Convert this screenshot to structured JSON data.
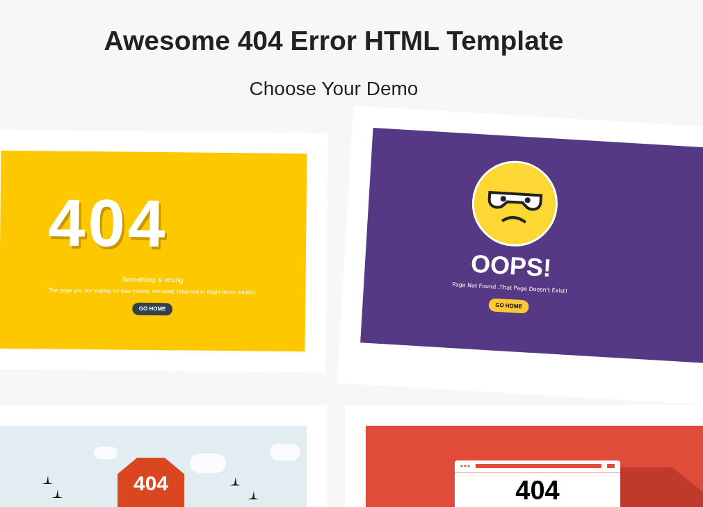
{
  "header": {
    "title": "Awesome 404 Error HTML Template",
    "subtitle": "Choose Your Demo"
  },
  "demos": [
    {
      "kind": "yellow",
      "heading": "404",
      "message": "Something is wrong",
      "detail": "The page you are looking for was moved, removed, renamed or might never existed.",
      "button": "GO HOME"
    },
    {
      "kind": "purple",
      "heading": "OOPS!",
      "message": "Page Not Found .That Page Doesn't Exist!",
      "button": "GO HOME"
    },
    {
      "kind": "sky",
      "heading": "404"
    },
    {
      "kind": "browser",
      "heading": "404"
    }
  ]
}
